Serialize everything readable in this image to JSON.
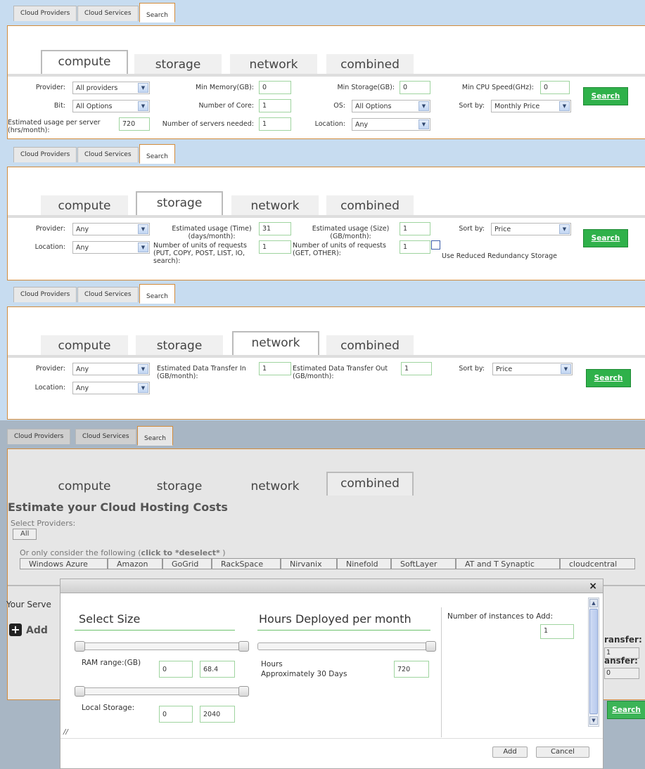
{
  "top_tabs": [
    "Cloud Providers",
    "Cloud Services",
    "Search"
  ],
  "sub_tabs": [
    "compute",
    "storage",
    "network",
    "combined"
  ],
  "compute": {
    "provider_label": "Provider:",
    "provider_value": "All providers",
    "min_memory_label": "Min Memory(GB):",
    "min_memory_value": "0",
    "min_storage_label": "Min Storage(GB):",
    "min_storage_value": "0",
    "min_cpu_label": "Min CPU Speed(GHz):",
    "min_cpu_value": "0",
    "bit_label": "Bit:",
    "bit_value": "All Options",
    "cores_label": "Number of Core:",
    "cores_value": "1",
    "os_label": "OS:",
    "os_value": "All Options",
    "sort_label": "Sort by:",
    "sort_value": "Monthly Price",
    "usage_label": "Estimated usage per server (hrs/month):",
    "usage_value": "720",
    "servers_label": "Number of servers needed:",
    "servers_value": "1",
    "location_label": "Location:",
    "location_value": "Any",
    "search_label": "Search"
  },
  "storage": {
    "provider_label": "Provider:",
    "provider_value": "Any",
    "time_label": "Estimated usage (Time) (days/month):",
    "time_value": "31",
    "size_label": "Estimated usage (Size) (GB/month):",
    "size_value": "1",
    "sort_label": "Sort by:",
    "sort_value": "Price",
    "location_label": "Location:",
    "location_value": "Any",
    "put_label": "Number of units of requests (PUT, COPY, POST, LIST, IO, search):",
    "put_value": "1",
    "get_label": "Number of units of requests (GET, OTHER):",
    "get_value": "1",
    "rrs_label": "Use Reduced Redundancy Storage",
    "search_label": "Search"
  },
  "network": {
    "provider_label": "Provider:",
    "provider_value": "Any",
    "in_label": "Estimated Data Transfer In (GB/month):",
    "in_value": "1",
    "out_label": "Estimated Data Transfer Out (GB/month):",
    "out_value": "1",
    "sort_label": "Sort by:",
    "sort_value": "Price",
    "location_label": "Location:",
    "location_value": "Any",
    "search_label": "Search"
  },
  "combined": {
    "heading": "Estimate your Cloud Hosting Costs",
    "select_providers": "Select Providers:",
    "all_label": "All",
    "consider_prefix": "Or only consider the following (",
    "consider_bold": "click to *deselect*",
    "consider_suffix": " )",
    "providers": [
      "Windows Azure",
      "Amazon",
      "GoGrid",
      "RackSpace",
      "Nirvanix",
      "Ninefold",
      "SoftLayer",
      "AT and T Synaptic",
      "cloudcentral"
    ],
    "your_servers": "Your Serve",
    "add_label": "Add",
    "transfer1": "ransfer:",
    "transfer1_value": "1",
    "transfer2": "ansfer:",
    "transfer2_value": "0",
    "search_label": "Search"
  },
  "dialog": {
    "close": "×",
    "select_size": "Select Size",
    "hours_deployed": "Hours Deployed per month",
    "instances_label": "Number of instances to Add:",
    "instances_value": "1",
    "ram_label": "RAM range:(GB)",
    "ram_min": "0",
    "ram_max": "68.4",
    "hours_label": "Hours",
    "hours_sub": "Approximately 30 Days",
    "hours_value": "720",
    "storage_label": "Local Storage:",
    "storage_min": "0",
    "storage_max": "2040",
    "add_button": "Add",
    "cancel_button": "Cancel"
  },
  "colors": {
    "search_green": "#2fb14a",
    "tab_border": "#d28b3b",
    "input_border": "#9fd49f"
  }
}
